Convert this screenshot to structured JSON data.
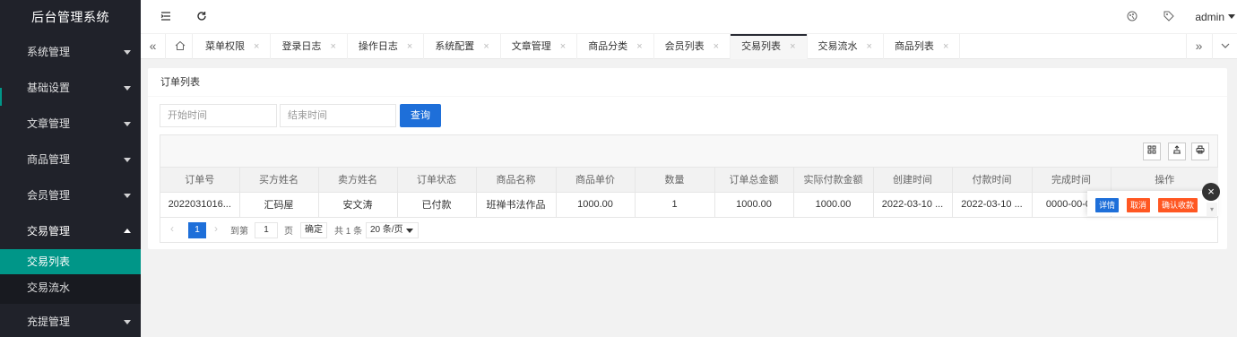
{
  "app": {
    "title": "后台管理系统"
  },
  "sidebar": {
    "items": [
      {
        "label": "系统管理"
      },
      {
        "label": "基础设置"
      },
      {
        "label": "文章管理"
      },
      {
        "label": "商品管理"
      },
      {
        "label": "会员管理"
      },
      {
        "label": "交易管理",
        "open": true
      },
      {
        "label": "充提管理"
      }
    ],
    "sub_items": [
      {
        "label": "交易列表",
        "active": true
      },
      {
        "label": "交易流水"
      }
    ]
  },
  "header": {
    "user": "admin",
    "icons": [
      "menu-toggle-icon",
      "refresh-icon",
      "theme-icon",
      "tag-icon"
    ]
  },
  "tabs": {
    "items": [
      {
        "label": "菜单权限"
      },
      {
        "label": "登录日志"
      },
      {
        "label": "操作日志"
      },
      {
        "label": "系统配置"
      },
      {
        "label": "文章管理"
      },
      {
        "label": "商品分类"
      },
      {
        "label": "会员列表"
      },
      {
        "label": "交易列表",
        "active": true
      },
      {
        "label": "交易流水"
      },
      {
        "label": "商品列表"
      }
    ],
    "close_glyph": "×"
  },
  "card": {
    "title": "订单列表"
  },
  "search": {
    "start_placeholder": "开始时间",
    "end_placeholder": "结束时间",
    "query_label": "查询"
  },
  "table": {
    "columns": [
      "订单号",
      "买方姓名",
      "卖方姓名",
      "订单状态",
      "商品名称",
      "商品单价",
      "数量",
      "订单总金额",
      "实际付款金额",
      "创建时间",
      "付款时间",
      "完成时间",
      "操作"
    ],
    "rows": [
      [
        "2022031016...",
        "汇码屋",
        "安文涛",
        "已付款",
        "班禅书法作品",
        "1000.00",
        "1",
        "1000.00",
        "1000.00",
        "2022-03-10 ...",
        "2022-03-10 ...",
        "0000-00-00",
        ""
      ]
    ],
    "actions": [
      {
        "label": "详情",
        "color": "#1e6fd9"
      },
      {
        "label": "取消",
        "color": "#ff5722"
      },
      {
        "label": "确认收款",
        "color": "#ff5722"
      }
    ]
  },
  "pager": {
    "current_page": "1",
    "goto_label": "到第",
    "page_input": "1",
    "page_unit": "页",
    "confirm_label": "确定",
    "total_label": "共 1 条",
    "page_size": "20 条/页"
  },
  "colors": {
    "sidebar_bg": "#20222a",
    "active_teal": "#009688",
    "primary_blue": "#1e6fd9",
    "danger_orange": "#ff5722"
  }
}
